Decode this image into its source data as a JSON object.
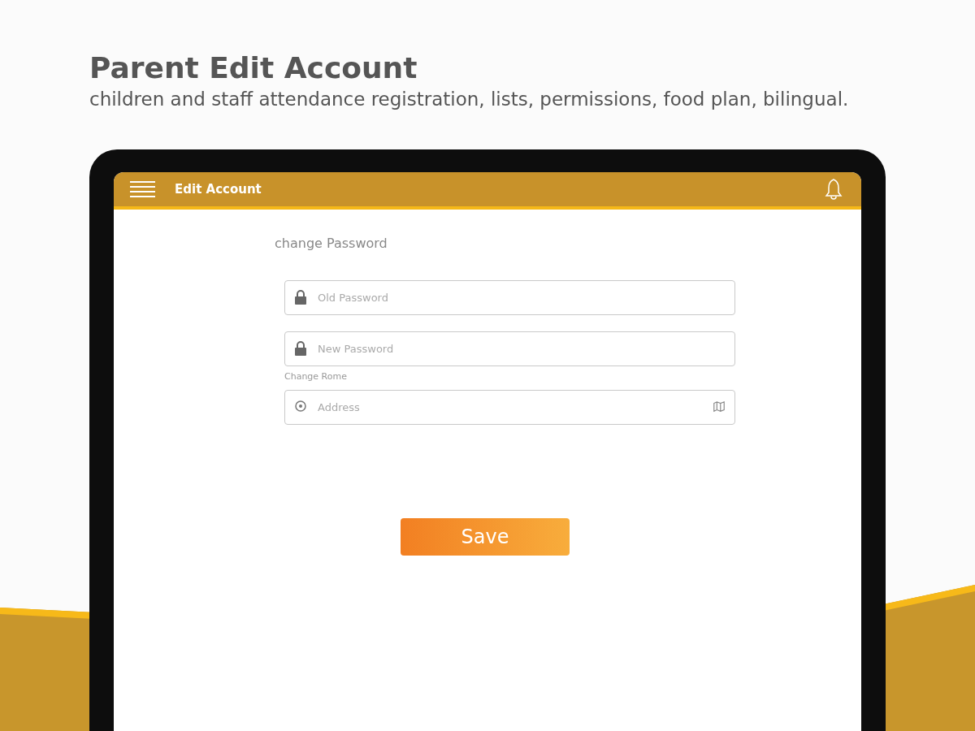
{
  "headline": {
    "title": "Parent Edit Account",
    "subtitle": "children and staff attendance registration, lists, permissions, food plan, bilingual."
  },
  "app_bar": {
    "title": "Edit Account"
  },
  "form": {
    "section_title": "change Password",
    "fields": [
      {
        "kind": "password",
        "placeholder": "Old Password"
      },
      {
        "kind": "password",
        "placeholder": "New Password"
      },
      {
        "kind": "address",
        "label": "Change Rome",
        "placeholder": "Address"
      }
    ],
    "save_button": "Save"
  }
}
